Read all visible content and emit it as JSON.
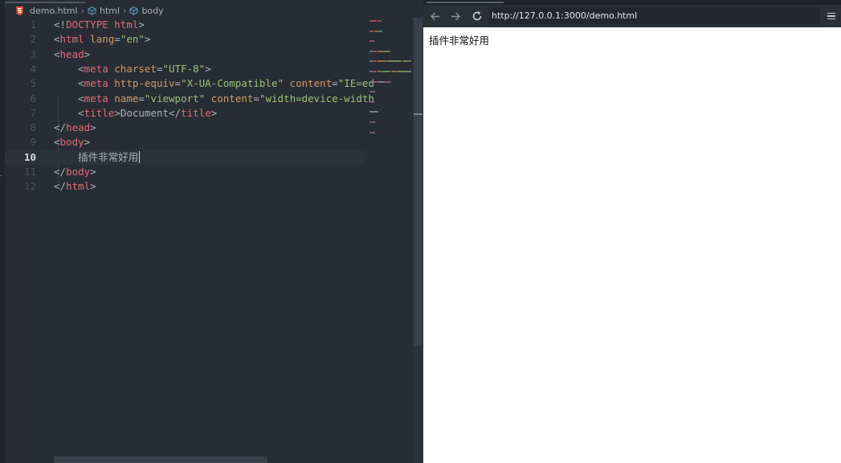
{
  "editor": {
    "breadcrumb": {
      "file": "demo.html",
      "items": [
        "html",
        "body"
      ]
    },
    "lines": [
      {
        "num": "1",
        "segments": [
          {
            "t": "<!",
            "c": "punct"
          },
          {
            "t": "DOCTYPE",
            "c": "kw"
          },
          {
            "t": " ",
            "c": "punct"
          },
          {
            "t": "html",
            "c": "kw"
          },
          {
            "t": ">",
            "c": "punct"
          }
        ]
      },
      {
        "num": "2",
        "segments": [
          {
            "t": "<",
            "c": "punct"
          },
          {
            "t": "html",
            "c": "tag"
          },
          {
            "t": " ",
            "c": "punct"
          },
          {
            "t": "lang",
            "c": "attr"
          },
          {
            "t": "=",
            "c": "punct"
          },
          {
            "t": "\"en\"",
            "c": "str"
          },
          {
            "t": ">",
            "c": "punct"
          }
        ]
      },
      {
        "num": "3",
        "segments": [
          {
            "t": "<",
            "c": "punct"
          },
          {
            "t": "head",
            "c": "tag"
          },
          {
            "t": ">",
            "c": "punct"
          }
        ]
      },
      {
        "num": "4",
        "segments": [
          {
            "t": "    <",
            "c": "punct"
          },
          {
            "t": "meta",
            "c": "tag"
          },
          {
            "t": " ",
            "c": "punct"
          },
          {
            "t": "charset",
            "c": "attr"
          },
          {
            "t": "=",
            "c": "punct"
          },
          {
            "t": "\"UTF-8\"",
            "c": "str"
          },
          {
            "t": ">",
            "c": "punct"
          }
        ]
      },
      {
        "num": "5",
        "segments": [
          {
            "t": "    <",
            "c": "punct"
          },
          {
            "t": "meta",
            "c": "tag"
          },
          {
            "t": " ",
            "c": "punct"
          },
          {
            "t": "http-equiv",
            "c": "attr"
          },
          {
            "t": "=",
            "c": "punct"
          },
          {
            "t": "\"X-UA-Compatible\"",
            "c": "str"
          },
          {
            "t": " ",
            "c": "punct"
          },
          {
            "t": "content",
            "c": "attr"
          },
          {
            "t": "=",
            "c": "punct"
          },
          {
            "t": "\"IE=ed",
            "c": "str"
          }
        ]
      },
      {
        "num": "6",
        "segments": [
          {
            "t": "    <",
            "c": "punct"
          },
          {
            "t": "meta",
            "c": "tag"
          },
          {
            "t": " ",
            "c": "punct"
          },
          {
            "t": "name",
            "c": "attr"
          },
          {
            "t": "=",
            "c": "punct"
          },
          {
            "t": "\"viewport\"",
            "c": "str"
          },
          {
            "t": " ",
            "c": "punct"
          },
          {
            "t": "content",
            "c": "attr"
          },
          {
            "t": "=",
            "c": "punct"
          },
          {
            "t": "\"width=device-width",
            "c": "str"
          }
        ]
      },
      {
        "num": "7",
        "segments": [
          {
            "t": "    <",
            "c": "punct"
          },
          {
            "t": "title",
            "c": "tag"
          },
          {
            "t": ">",
            "c": "punct"
          },
          {
            "t": "Document",
            "c": "txt"
          },
          {
            "t": "</",
            "c": "punct"
          },
          {
            "t": "title",
            "c": "tag"
          },
          {
            "t": ">",
            "c": "punct"
          }
        ]
      },
      {
        "num": "8",
        "segments": [
          {
            "t": "</",
            "c": "punct"
          },
          {
            "t": "head",
            "c": "tag"
          },
          {
            "t": ">",
            "c": "punct"
          }
        ]
      },
      {
        "num": "9",
        "segments": [
          {
            "t": "<",
            "c": "punct"
          },
          {
            "t": "body",
            "c": "tag"
          },
          {
            "t": ">",
            "c": "punct"
          }
        ]
      },
      {
        "num": "10",
        "segments": [
          {
            "t": "    插件非常好用",
            "c": "txt"
          }
        ],
        "active": true,
        "cursor": true
      },
      {
        "num": "11",
        "segments": [
          {
            "t": "</",
            "c": "punct"
          },
          {
            "t": "body",
            "c": "tag"
          },
          {
            "t": ">",
            "c": "punct"
          }
        ]
      },
      {
        "num": "12",
        "segments": [
          {
            "t": "</",
            "c": "punct"
          },
          {
            "t": "html",
            "c": "tag"
          },
          {
            "t": ">",
            "c": "punct"
          }
        ]
      }
    ]
  },
  "browser": {
    "url": "http://127.0.0.1:3000/demo.html",
    "page_text": "插件非常好用",
    "icons": {
      "back": "arrow-left-icon",
      "forward": "arrow-right-icon",
      "reload": "reload-icon",
      "menu": "hamburger-menu-icon"
    }
  },
  "colors": {
    "editor_bg": "#282c34",
    "tag": "#e06c75",
    "attribute": "#d19a66",
    "string": "#98c379",
    "punctuation": "#abb2bf",
    "browser_toolbar": "#2b2f36",
    "html5_icon": "#e44d26",
    "cube_icon": "#519aba"
  }
}
